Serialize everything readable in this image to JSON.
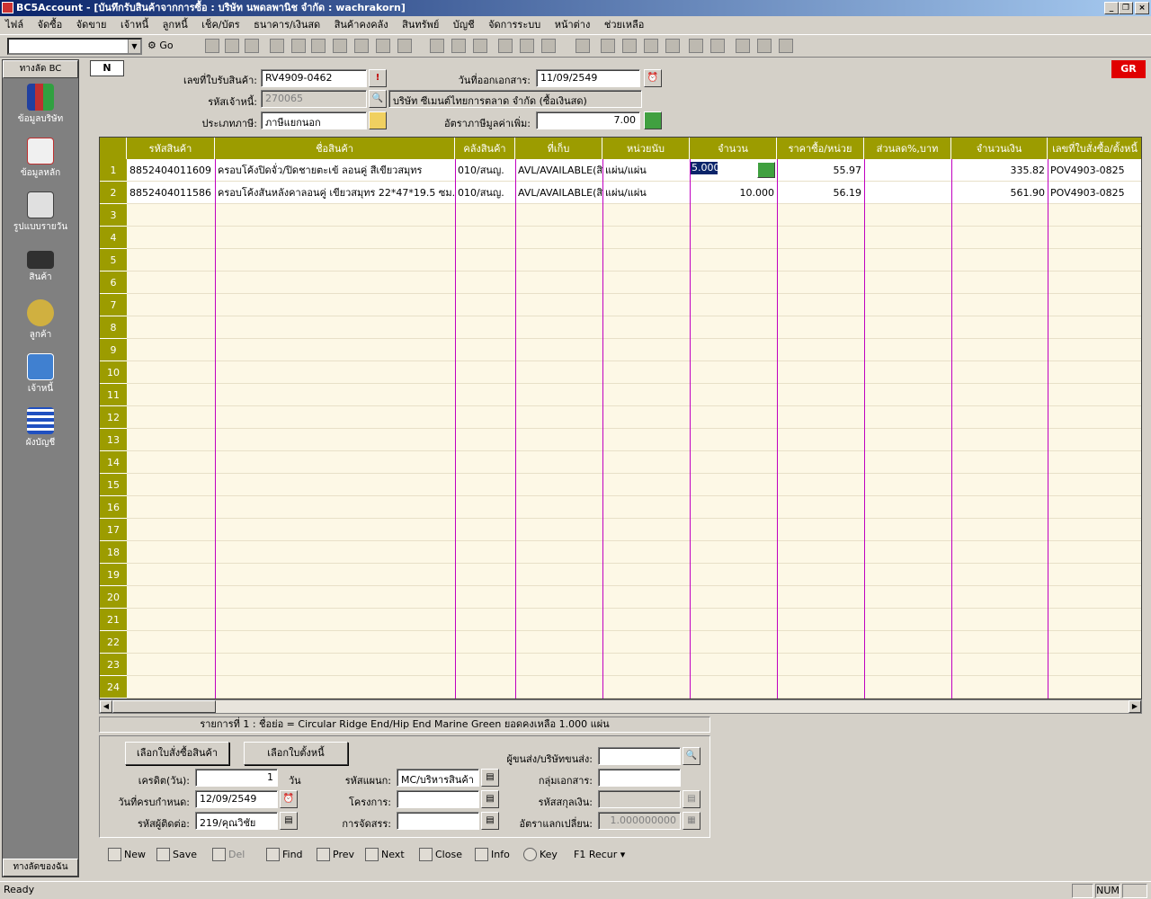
{
  "window": {
    "title": "BC5Account - [บันทึกรับสินค้าจากการซื้อ : บริษัท นพดลพานิช จำกัด : wachrakorn]"
  },
  "menu": [
    "ไฟล์",
    "จัดซื้อ",
    "จัดขาย",
    "เจ้าหนี้",
    "ลูกหนี้",
    "เช็ค/บัตร",
    "ธนาคาร/เงินสด",
    "สินค้าคงคลัง",
    "สินทรัพย์",
    "บัญชี",
    "จัดการระบบ",
    "หน้าต่าง",
    "ช่วยเหลือ"
  ],
  "toolbar": {
    "go_label": "Go"
  },
  "sidebar": {
    "header": "ทางลัด BC",
    "footer": "ทางลัดของฉัน",
    "items": [
      {
        "label": "ข้อมูลบริษัท",
        "icon": "books-icon"
      },
      {
        "label": "ข้อมูลหลัก",
        "icon": "document-icon"
      },
      {
        "label": "รูปแบบรายวัน",
        "icon": "pen-icon"
      },
      {
        "label": "สินค้า",
        "icon": "chip-icon"
      },
      {
        "label": "ลูกค้า",
        "icon": "money-bag-icon"
      },
      {
        "label": "เจ้าหนี้",
        "icon": "cycle-icon"
      },
      {
        "label": "ผังบัญชี",
        "icon": "chart-icon"
      }
    ]
  },
  "form": {
    "mode_badge": "N",
    "doc_type_badge": "GR",
    "receipt_no_label": "เลขที่ใบรับสินค้า:",
    "receipt_no": "RV4909-0462",
    "doc_date_label": "วันที่ออกเอกสาร:",
    "doc_date": "11/09/2549",
    "creditor_code_label": "รหัสเจ้าหนี้:",
    "creditor_code": "270065",
    "creditor_name": "บริษัท ซีเมนต์ไทยการตลาด จำกัด (ซื้อเงินสด)",
    "tax_type_label": "ประเภทภาษี:",
    "tax_type": "ภาษีแยกนอก",
    "vat_rate_label": "อัตราภาษีมูลค่าเพิ่ม:",
    "vat_rate": "7.00"
  },
  "grid": {
    "columns": [
      "รหัสสินค้า",
      "ชื่อสินค้า",
      "คลังสินค้า",
      "ที่เก็บ",
      "หน่วยนับ",
      "จำนวน",
      "ราคาซื้อ/หน่วย",
      "ส่วนลด%,บาท",
      "จำนวนเงิน",
      "เลขที่ใบสั่งซื้อ/ตั้งหนี้"
    ],
    "row_numbers": [
      "1",
      "2",
      "3",
      "4",
      "5",
      "6",
      "7",
      "8",
      "9",
      "10",
      "11",
      "12",
      "13",
      "14",
      "15",
      "16",
      "17",
      "18",
      "19",
      "20",
      "21",
      "22",
      "23",
      "24"
    ],
    "rows": [
      {
        "code": "8852404011609",
        "name": "ครอบโค้งปิดจั่ว/ปิดชายตะเข้ ลอนคู่ สีเขียวสมุทร",
        "warehouse": "010/สนญ.",
        "location": "AVL/AVAILABLE(สิน",
        "unit": "แผ่น/แผ่น",
        "qty": "5.000",
        "price": "55.97",
        "discount": "",
        "amount": "335.82",
        "po": "POV4903-0825"
      },
      {
        "code": "8852404011586",
        "name": "ครอบโค้งสันหลังคาลอนคู่ เขียวสมุทร  22*47*19.5 ซม.",
        "warehouse": "010/สนญ.",
        "location": "AVL/AVAILABLE(สิน",
        "unit": "แผ่น/แผ่น",
        "qty": "10.000",
        "price": "56.19",
        "discount": "",
        "amount": "561.90",
        "po": "POV4903-0825"
      }
    ]
  },
  "status_line": "รายการที่ 1 : ชื่อย่อ = Circular Ridge End/Hip End Marine Green ยอดคงเหลือ 1.000 แผ่น",
  "bottom": {
    "select_po_button": "เลือกใบสั่งซื้อสินค้า",
    "select_ap_button": "เลือกใบตั้งหนี้",
    "credit_days_label": "เครดิต(วัน):",
    "credit_days": "1",
    "days_unit": "วัน",
    "due_date_label": "วันที่ครบกำหนด:",
    "due_date": "12/09/2549",
    "contact_label": "รหัสผู้ติดต่อ:",
    "contact": "219/คุณวิชัย",
    "dept_label": "รหัสแผนก:",
    "dept": "MC/บริหารสินค้า",
    "project_label": "โครงการ:",
    "project": "",
    "allocation_label": "การจัดสรร:",
    "allocation": "",
    "shipper_label": "ผู้ขนส่ง/บริษัทขนส่ง:",
    "shipper": "",
    "doc_group_label": "กลุ่มเอกสาร:",
    "doc_group": "",
    "currency_label": "รหัสสกุลเงิน:",
    "currency": "",
    "exchange_rate_label": "อัตราแลกเปลี่ยน:",
    "exchange_rate": "1.000000000"
  },
  "actions": {
    "new": "New",
    "save": "Save",
    "del": "Del",
    "find": "Find",
    "prev": "Prev",
    "next": "Next",
    "close": "Close",
    "info": "Info",
    "key": "Key",
    "recur": "F1 Recur"
  },
  "statusbar": {
    "text": "Ready",
    "num": "NUM"
  }
}
